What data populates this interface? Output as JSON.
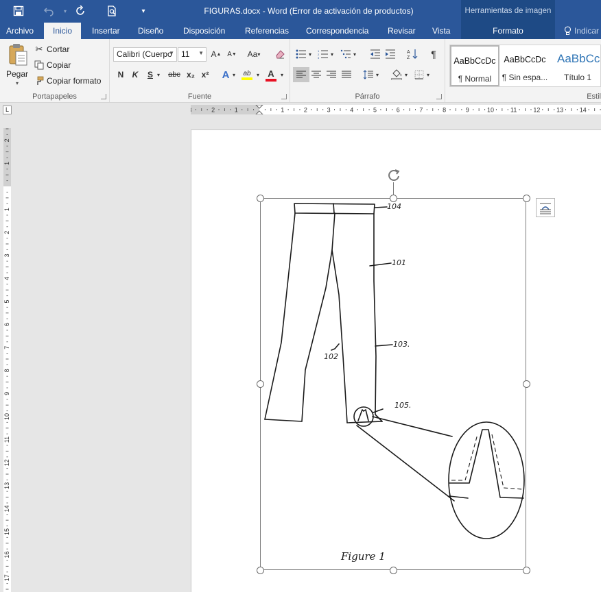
{
  "titlebar": {
    "title": "FIGURAS.docx - Word (Error de activación de productos)",
    "context_group": "Herramientas de imagen",
    "icons": [
      "save-icon",
      "undo-icon",
      "redo-icon",
      "print-preview-icon",
      "customize-qat-icon"
    ]
  },
  "tabs": [
    {
      "label": "Archivo"
    },
    {
      "label": "Inicio"
    },
    {
      "label": "Insertar"
    },
    {
      "label": "Diseño"
    },
    {
      "label": "Disposición"
    },
    {
      "label": "Referencias"
    },
    {
      "label": "Correspondencia"
    },
    {
      "label": "Revisar"
    },
    {
      "label": "Vista"
    },
    {
      "label": "Formato"
    },
    {
      "label": "Indicar"
    }
  ],
  "ribbon": {
    "clipboard": {
      "paste_label": "Pegar",
      "cut_label": "Cortar",
      "copy_label": "Copiar",
      "format_painter_label": "Copiar formato",
      "group_label": "Portapapeles"
    },
    "font": {
      "font_name": "Calibri (Cuerpo",
      "font_size": "11",
      "group_label": "Fuente",
      "grow_label": "A",
      "shrink_label": "A",
      "case_label": "Aa",
      "bold_label": "N",
      "italic_label": "K",
      "underline_label": "S",
      "strike_label": "abc",
      "subscript_label": "x₂",
      "superscript_label": "x²",
      "text_effects_label": "A",
      "highlight_label": "ab",
      "font_color_label": "A"
    },
    "paragraph": {
      "group_label": "Párrafo"
    },
    "styles": {
      "items": [
        {
          "sample": "AaBbCcDc",
          "name": "¶ Normal"
        },
        {
          "sample": "AaBbCcDc",
          "name": "¶ Sin espa..."
        },
        {
          "sample": "AaBbCc",
          "name": "Título 1"
        }
      ],
      "group_label": "Estil"
    }
  },
  "rulers": {
    "corner_label": "L",
    "h_labels": [
      "3",
      "2",
      "1",
      "1",
      "2",
      "3",
      "4",
      "5",
      "6",
      "7",
      "8",
      "9",
      "10",
      "11",
      "12",
      "13",
      "14"
    ],
    "v_labels": [
      "2",
      "1",
      "1",
      "2",
      "3",
      "4",
      "5",
      "6",
      "7",
      "8",
      "9",
      "10",
      "11",
      "12",
      "13",
      "14",
      "15",
      "16",
      "17"
    ]
  },
  "figure": {
    "labels": {
      "waistband": "104",
      "leg_outer": "101",
      "leg_inner": "102",
      "leg_seam": "103.",
      "detail": "105.",
      "caption": "Figure 1"
    }
  },
  "colors": {
    "brand": "#2b579a",
    "context_tab": "#1e4a85",
    "ribbon_bg": "#f3f3f3",
    "canvas_bg": "#e6e6e6"
  }
}
